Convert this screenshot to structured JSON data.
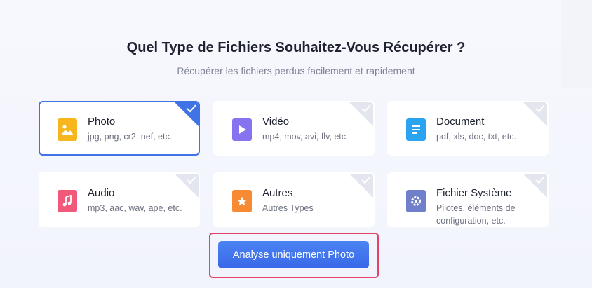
{
  "header": {
    "title": "Quel Type de Fichiers Souhaitez-Vous Récupérer ?",
    "subtitle": "Récupérer les fichiers perdus facilement et rapidement"
  },
  "file_types": [
    {
      "label": "Photo",
      "description": "jpg, png, cr2, nef, etc.",
      "icon": "image-icon",
      "color": "#f7b51e",
      "selected": true
    },
    {
      "label": "Vidéo",
      "description": "mp4, mov, avi, flv, etc.",
      "icon": "play-icon",
      "color": "#8673f0",
      "selected": false
    },
    {
      "label": "Document",
      "description": "pdf, xls, doc, txt, etc.",
      "icon": "document-icon",
      "color": "#2aa3f3",
      "selected": false
    },
    {
      "label": "Audio",
      "description": "mp3, aac, wav, ape, etc.",
      "icon": "music-note-icon",
      "color": "#f2587a",
      "selected": false
    },
    {
      "label": "Autres",
      "description": "Autres Types",
      "icon": "star-icon",
      "color": "#f78a32",
      "selected": false
    },
    {
      "label": "Fichier Système",
      "description": "Pilotes, éléments de configuration, etc.",
      "icon": "gear-icon",
      "color": "#6f7fc9",
      "selected": false
    }
  ],
  "action": {
    "label": "Analyse uniquement Photo"
  },
  "colors": {
    "accent": "#3f73e6",
    "highlight_frame": "#e5436b"
  }
}
